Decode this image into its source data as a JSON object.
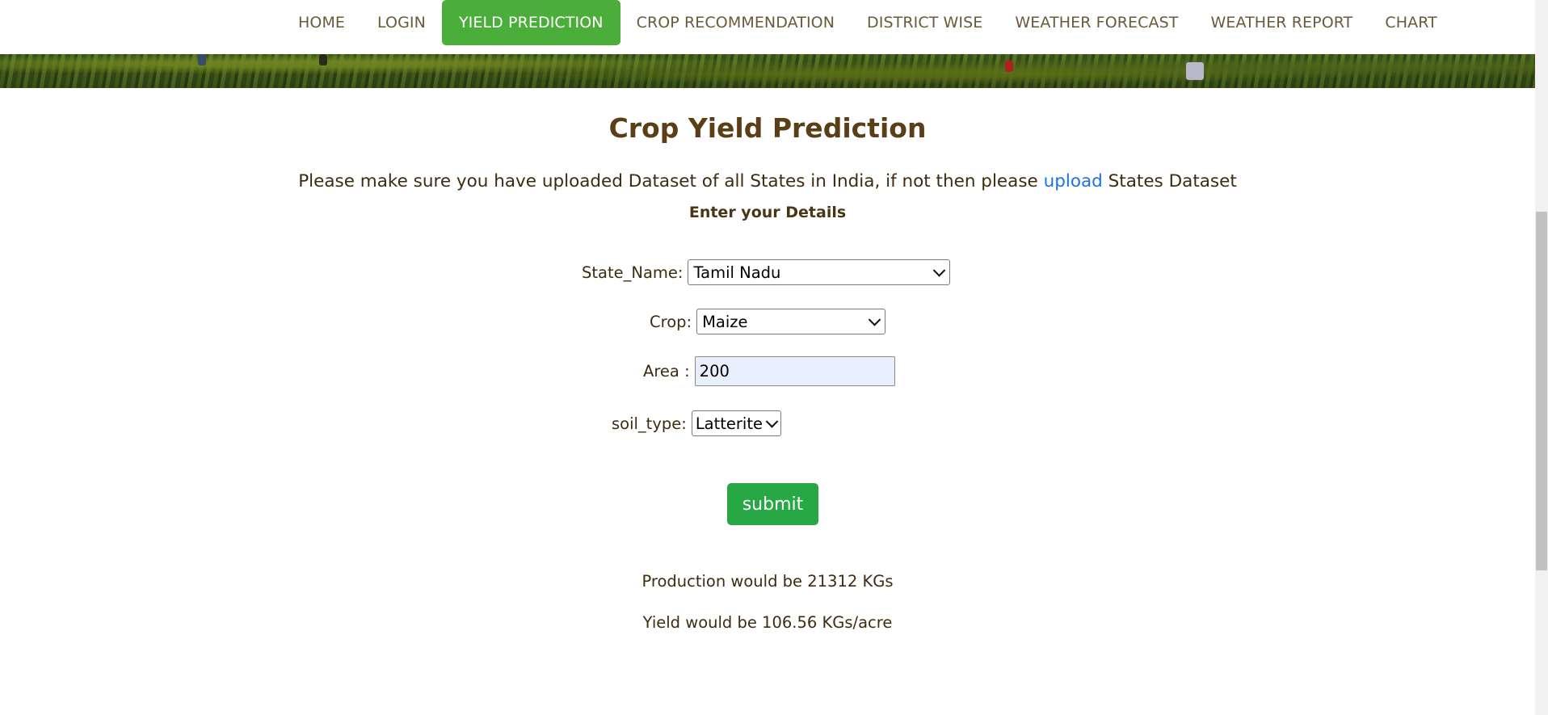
{
  "nav": {
    "items": [
      {
        "label": "HOME"
      },
      {
        "label": "LOGIN"
      },
      {
        "label": "YIELD PREDICTION",
        "active": true
      },
      {
        "label": "CROP RECOMMENDATION"
      },
      {
        "label": "DISTRICT WISE"
      },
      {
        "label": "WEATHER FORECAST"
      },
      {
        "label": "WEATHER REPORT"
      },
      {
        "label": "CHART"
      }
    ]
  },
  "main": {
    "title": "Crop Yield Prediction",
    "notice_before": "Please make sure you have uploaded Dataset of all States in India, if not then please ",
    "notice_link": "upload",
    "notice_after": " States Dataset",
    "subheading": "Enter your Details"
  },
  "form": {
    "state_label": "State_Name:",
    "state_value": "Tamil Nadu",
    "crop_label": "Crop:",
    "crop_value": "Maize",
    "area_label": "Area :",
    "area_value": "200",
    "soil_label": "soil_type:",
    "soil_value": "Latterite",
    "submit_label": "submit"
  },
  "results": {
    "production": "Production would be 21312 KGs",
    "yield": "Yield would be 106.56 KGs/acre"
  },
  "colors": {
    "accent_green": "#4bae3b",
    "button_green": "#28a745",
    "heading_brown": "#5a3e16",
    "link_blue": "#1a73e8"
  }
}
